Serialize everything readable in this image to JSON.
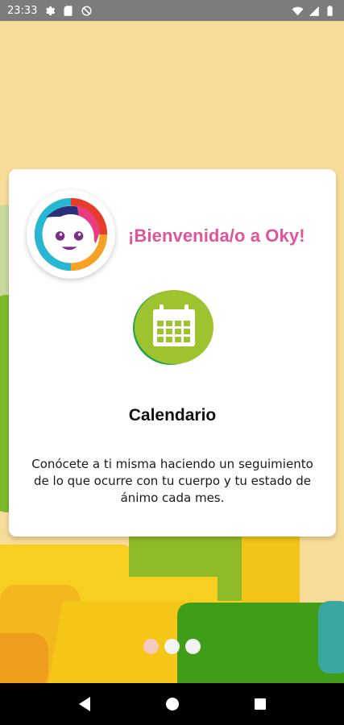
{
  "status_bar": {
    "time": "23:33",
    "left_icons": [
      "settings-icon",
      "sd-card-icon",
      "do-not-disturb-icon"
    ],
    "right_icons": [
      "wifi-icon",
      "cell-signal-icon",
      "battery-icon"
    ]
  },
  "onboarding": {
    "welcome_text": "¡Bienvenida/o a Oky!",
    "feature_title": "Calendario",
    "feature_description": "Conócete a ti misma haciendo un seguimiento de lo que ocurre con tu cuerpo y tu estado de ánimo cada mes.",
    "feature_icon": "calendar-icon",
    "page_indicator": {
      "total": 3,
      "current": 1
    }
  },
  "nav_bar": {
    "buttons": [
      "back-icon",
      "home-icon",
      "recents-icon"
    ]
  },
  "colors": {
    "background": "#f7db99",
    "welcome_text": "#e0559a",
    "calendar_green": "#9dc42e",
    "status_bar": "#7c7c7c"
  }
}
